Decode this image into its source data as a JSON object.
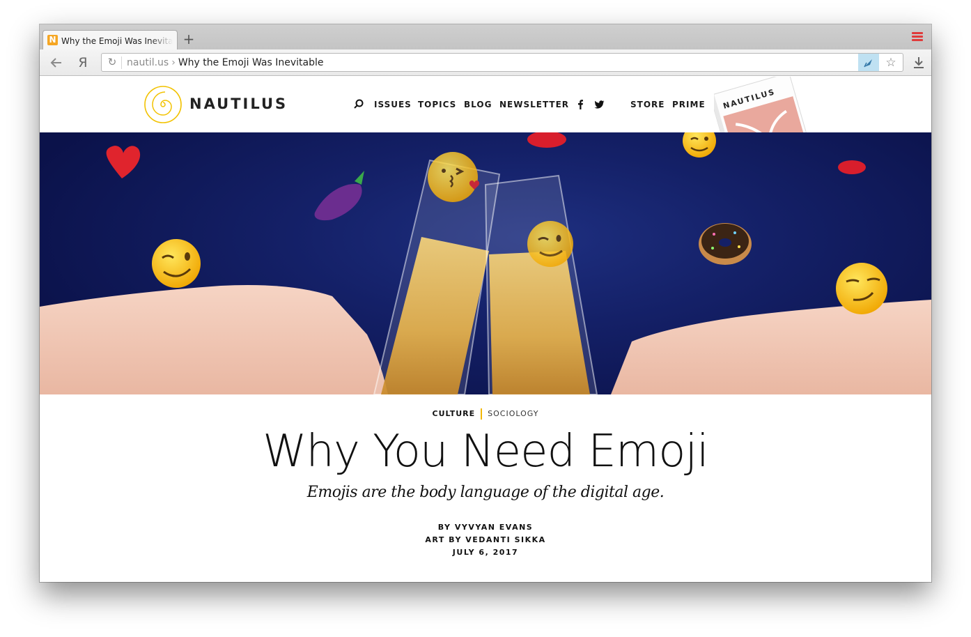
{
  "browser": {
    "tab": {
      "favicon_letter": "N",
      "title": "Why the Emoji Was Inevitable"
    },
    "new_tab_symbol": "+",
    "address_bar": {
      "domain": "nautil.us",
      "separator": "›",
      "page_title": "Why the Emoji Was Inevitable"
    },
    "icons": {
      "back": "arrow-left-icon",
      "yandex": "yandex-icon",
      "reload": "reload-icon",
      "protect": "shield-rocket-icon",
      "bookmark": "star-icon",
      "download": "download-icon",
      "menu": "hamburger-menu-icon"
    },
    "yandex_glyph": "Я",
    "menu_color": "#e03b3b"
  },
  "site": {
    "logo_text": "NAUTILUS",
    "logo_color": "#f2c200",
    "nav": {
      "search_icon": "search-icon",
      "issues": "ISSUES",
      "topics": "TOPICS",
      "blog": "BLOG",
      "newsletter": "NEWSLETTER",
      "facebook_icon": "facebook-icon",
      "twitter_icon": "twitter-icon",
      "store": "STORE",
      "prime": "PRIME"
    },
    "magazine_cover_title": "NAUTILUS"
  },
  "hero": {
    "description_icons": [
      "heart-emoji",
      "eggplant-emoji",
      "kiss-emoji",
      "lips-emoji",
      "wink-emoji",
      "donut-emoji",
      "smirk-emoji",
      "champagne-glasses"
    ]
  },
  "article": {
    "category_primary": "CULTURE",
    "category_secondary": "SOCIOLOGY",
    "accent_color": "#f2b705",
    "title": "Why You Need Emoji",
    "dek": "Emojis are the body language of the digital age.",
    "author": "BY VYVYAN EVANS",
    "art_credit": "ART BY VEDANTI SIKKA",
    "date": "JULY 6, 2017"
  }
}
